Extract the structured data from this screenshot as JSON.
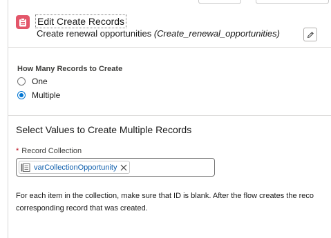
{
  "header": {
    "title": "Edit Create Records",
    "subtitle_name": "Create renewal opportunities",
    "subtitle_api": "(Create_renewal_opportunities)",
    "icon": "clipboard-icon",
    "edit_icon": "pencil-icon"
  },
  "how_many": {
    "label": "How Many Records to Create",
    "options": [
      {
        "label": "One",
        "selected": false
      },
      {
        "label": "Multiple",
        "selected": true
      }
    ]
  },
  "select_values": {
    "title": "Select Values to Create Multiple Records",
    "field_label": "Record Collection",
    "required_marker": "*",
    "pill_label": "varCollectionOpportunity",
    "pill_icon": "collection-icon",
    "help_line1": "For each item in the collection, make sure that ID is blank. After the flow creates the reco",
    "help_line2": "corresponding record that was created."
  },
  "colors": {
    "accent": "#0176d3",
    "icon_bg": "#e3566a",
    "required": "#ba0517"
  }
}
